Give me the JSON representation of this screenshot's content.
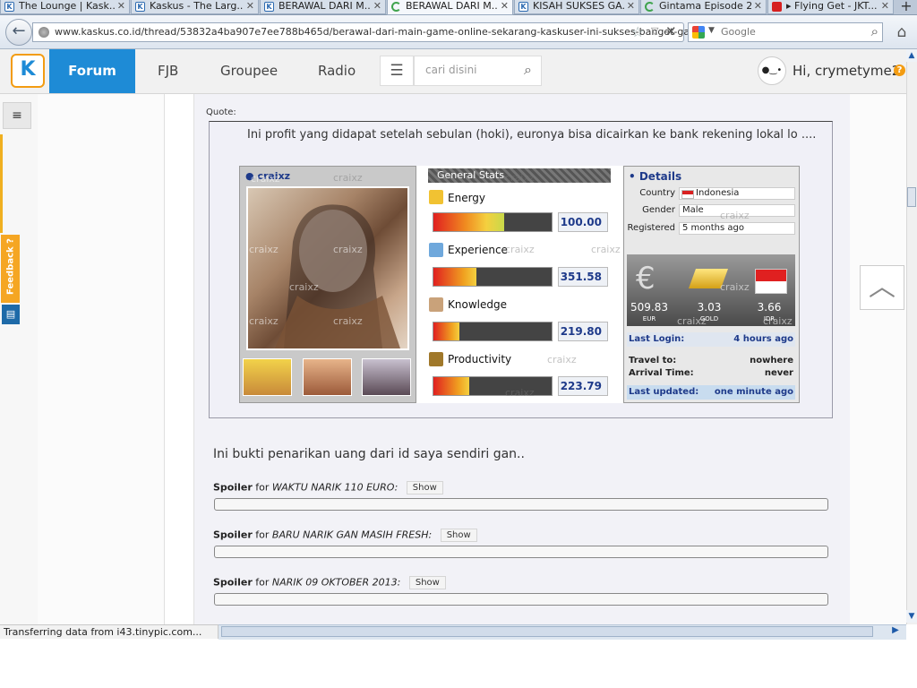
{
  "browser": {
    "tabs": [
      {
        "label": "The Lounge | Kask...",
        "icon": "kaskus-icon",
        "active": false
      },
      {
        "label": "Kaskus - The Larg...",
        "icon": "kaskus-icon",
        "active": false
      },
      {
        "label": "BERAWAL DARI M...",
        "icon": "kaskus-icon",
        "active": false
      },
      {
        "label": "BERAWAL DARI M...",
        "icon": "loading-icon",
        "active": true
      },
      {
        "label": "KISAH SUKSES GA...",
        "icon": "kaskus-icon",
        "active": false
      },
      {
        "label": "Gintama Episode 2...",
        "icon": "loading-icon",
        "active": false
      },
      {
        "label": "▸ Flying Get - JKT...",
        "icon": "youtube-icon",
        "active": false
      }
    ],
    "new_tab": "+",
    "url": "www.kaskus.co.id/thread/53832a4ba907e7ee788b465d/berawal-dari-main-game-online-sekarang-kaskuser-ini-sukses-banget-gan/",
    "search_placeholder": "Google",
    "status": "Transferring data from i43.tinypic.com..."
  },
  "header": {
    "logo": "K",
    "nav": [
      "Forum",
      "FJB",
      "Groupee",
      "Radio"
    ],
    "search_placeholder": "cari disini",
    "greeting": "Hi, crymetyme2",
    "help": "?"
  },
  "sidebar": {
    "feedback": "Feedback ?",
    "menu": "≡"
  },
  "post": {
    "quote_label": "Quote:",
    "quote_text": "Ini profit yang didapat setelah sebulan (hoki), euronya bisa dicairkan ke bank rekening lokal lo ....",
    "bukti_text": "Ini bukti penarikan uang dari id saya sendiri gan..",
    "spoilers": [
      {
        "prefix": "Spoiler",
        "for": "for",
        "title": "WAKTU NARIK 110 EURO:",
        "button": "Show"
      },
      {
        "prefix": "Spoiler",
        "for": "for",
        "title": "BARU NARIK GAN MASIH FRESH:",
        "button": "Show"
      },
      {
        "prefix": "Spoiler",
        "for": "for",
        "title": "NARIK 09 OKTOBER 2013:",
        "button": "Show"
      }
    ]
  },
  "card": {
    "username": "craixz",
    "watermark": "craixz",
    "stats_title": "General Stats",
    "stats": [
      {
        "label": "Energy",
        "value": "100.00",
        "fill": 0.6
      },
      {
        "label": "Experience",
        "value": "351.58",
        "fill": 0.36
      },
      {
        "label": "Knowledge",
        "value": "219.80",
        "fill": 0.22
      },
      {
        "label": "Productivity",
        "value": "223.79",
        "fill": 0.3
      }
    ],
    "details_title": "• Details",
    "details": [
      {
        "label": "Country",
        "value": "Indonesia"
      },
      {
        "label": "Gender",
        "value": "Male"
      },
      {
        "label": "Registered",
        "value": "5 months ago"
      }
    ],
    "currencies": [
      {
        "amount": "509.83",
        "code": "EUR"
      },
      {
        "amount": "3.03",
        "code": "GOLD"
      },
      {
        "amount": "3.66",
        "code": "IDR"
      }
    ],
    "last_login_label": "Last Login:",
    "last_login_value": "4 hours ago",
    "travel_label": "Travel to:",
    "travel_value": "nowhere",
    "arrival_label": "Arrival Time:",
    "arrival_value": "never",
    "last_updated_label": "Last updated:",
    "last_updated_value": "one minute ago"
  }
}
